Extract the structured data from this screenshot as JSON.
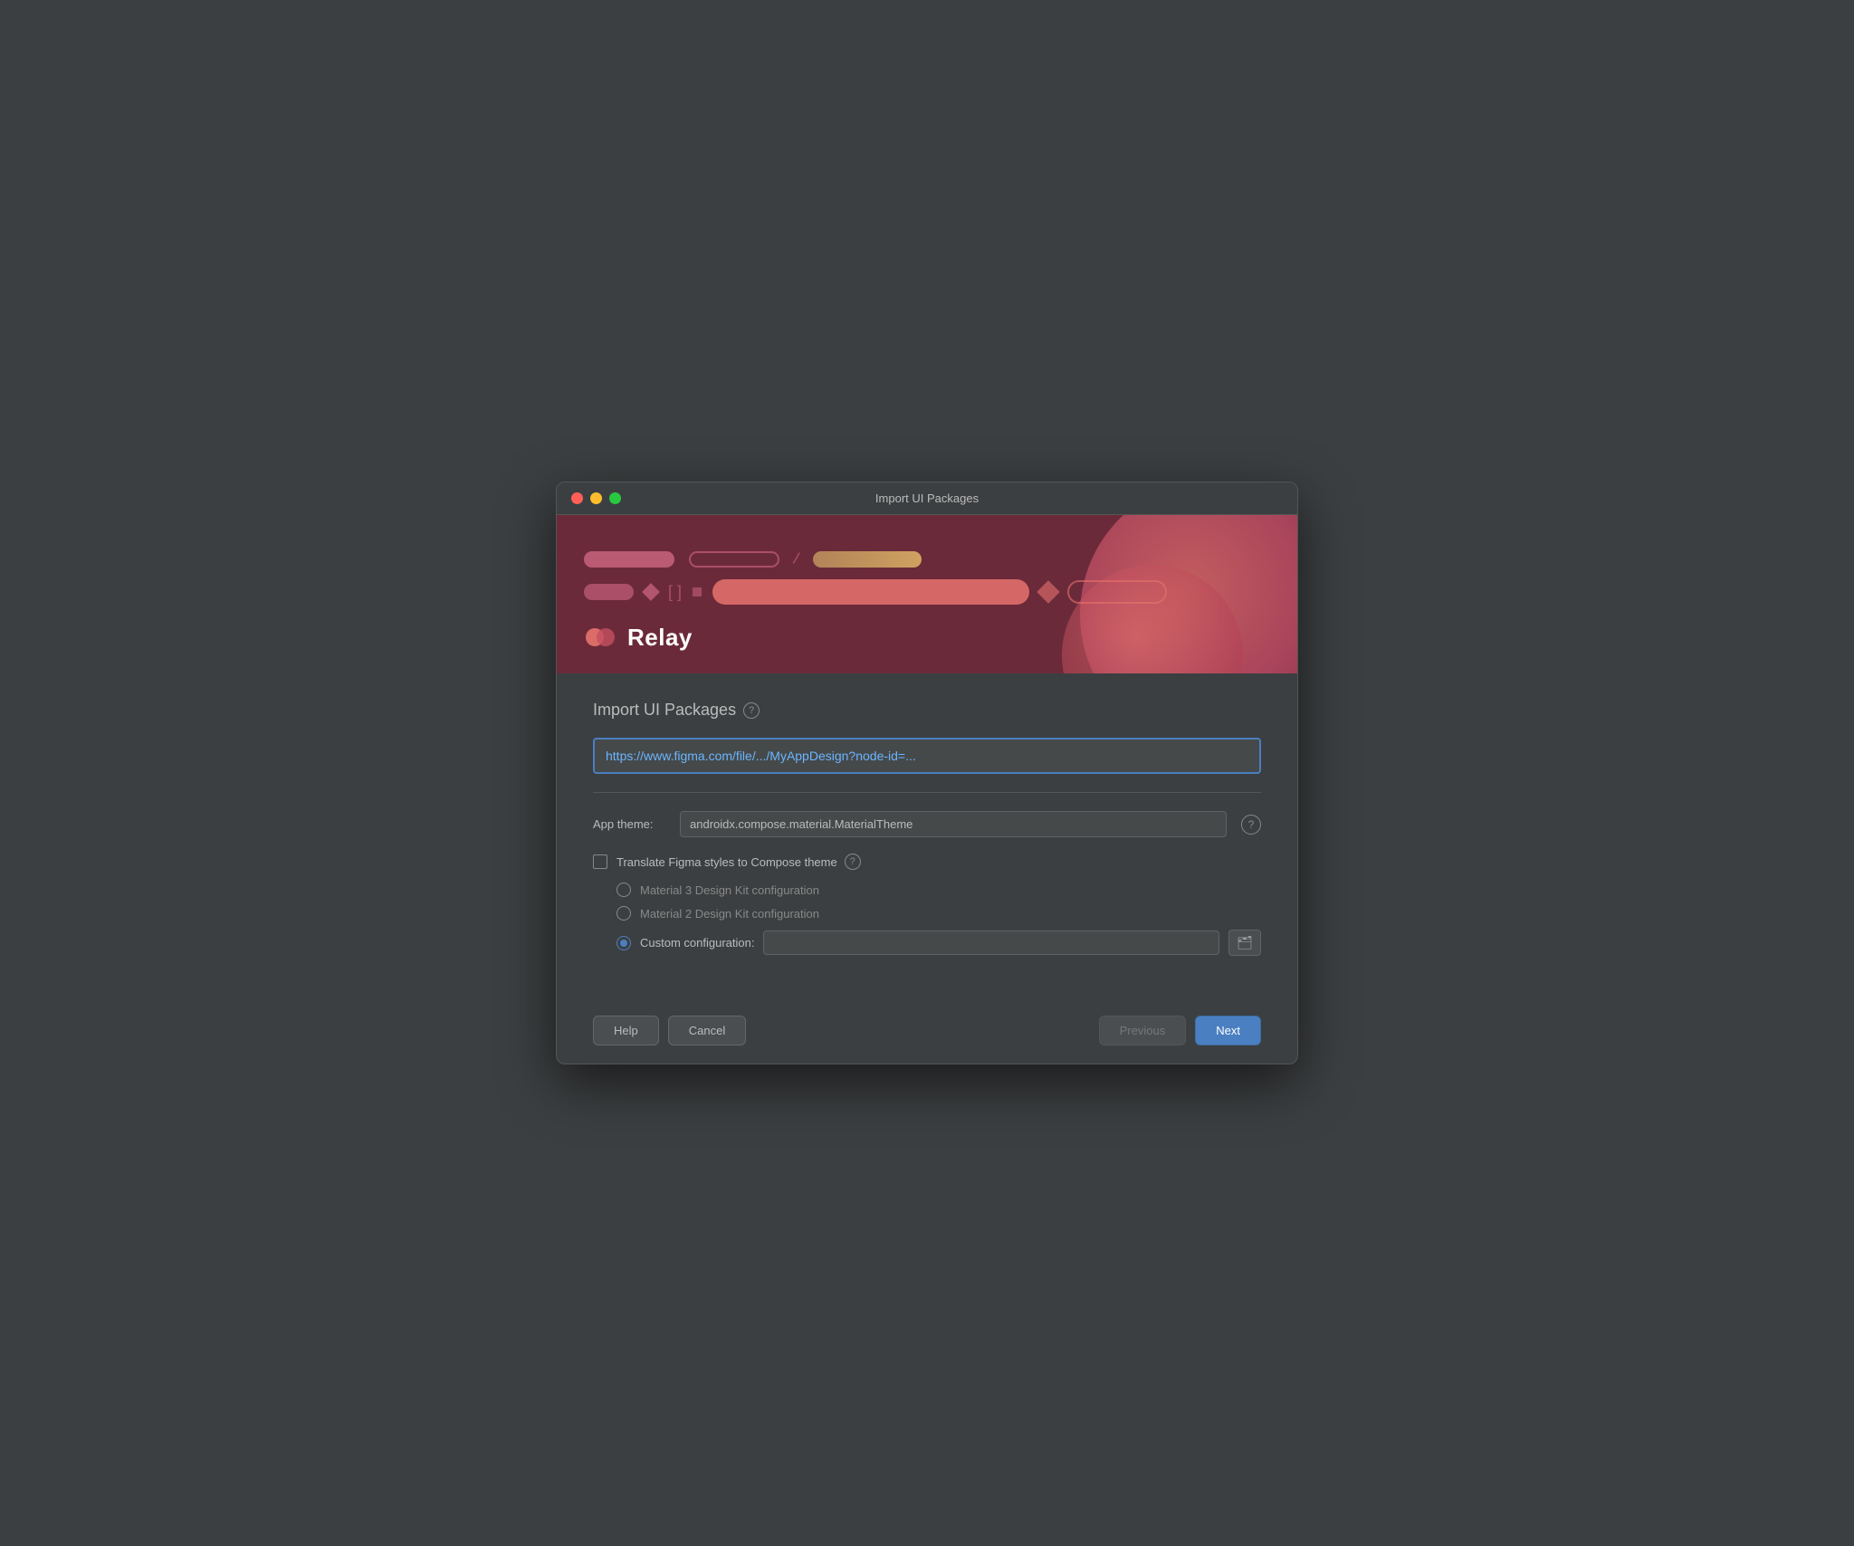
{
  "window": {
    "title": "Import UI Packages"
  },
  "banner": {
    "logo_text": "Relay"
  },
  "content": {
    "section_title": "Import UI Packages",
    "url_placeholder": "https://www.figma.com/file/.../MyAppDesign?node-id=...",
    "url_value": "https://www.figma.com/file/.../MyAppDesign?node-id=...",
    "app_theme_label": "App theme:",
    "app_theme_value": "androidx.compose.material.MaterialTheme",
    "translate_label": "Translate Figma styles to Compose theme",
    "material3_label": "Material 3 Design Kit configuration",
    "material2_label": "Material 2 Design Kit configuration",
    "custom_label": "Custom configuration:",
    "custom_value": ""
  },
  "footer": {
    "help_label": "Help",
    "cancel_label": "Cancel",
    "previous_label": "Previous",
    "next_label": "Next"
  },
  "icons": {
    "help_circle": "?",
    "folder": "🗂"
  }
}
